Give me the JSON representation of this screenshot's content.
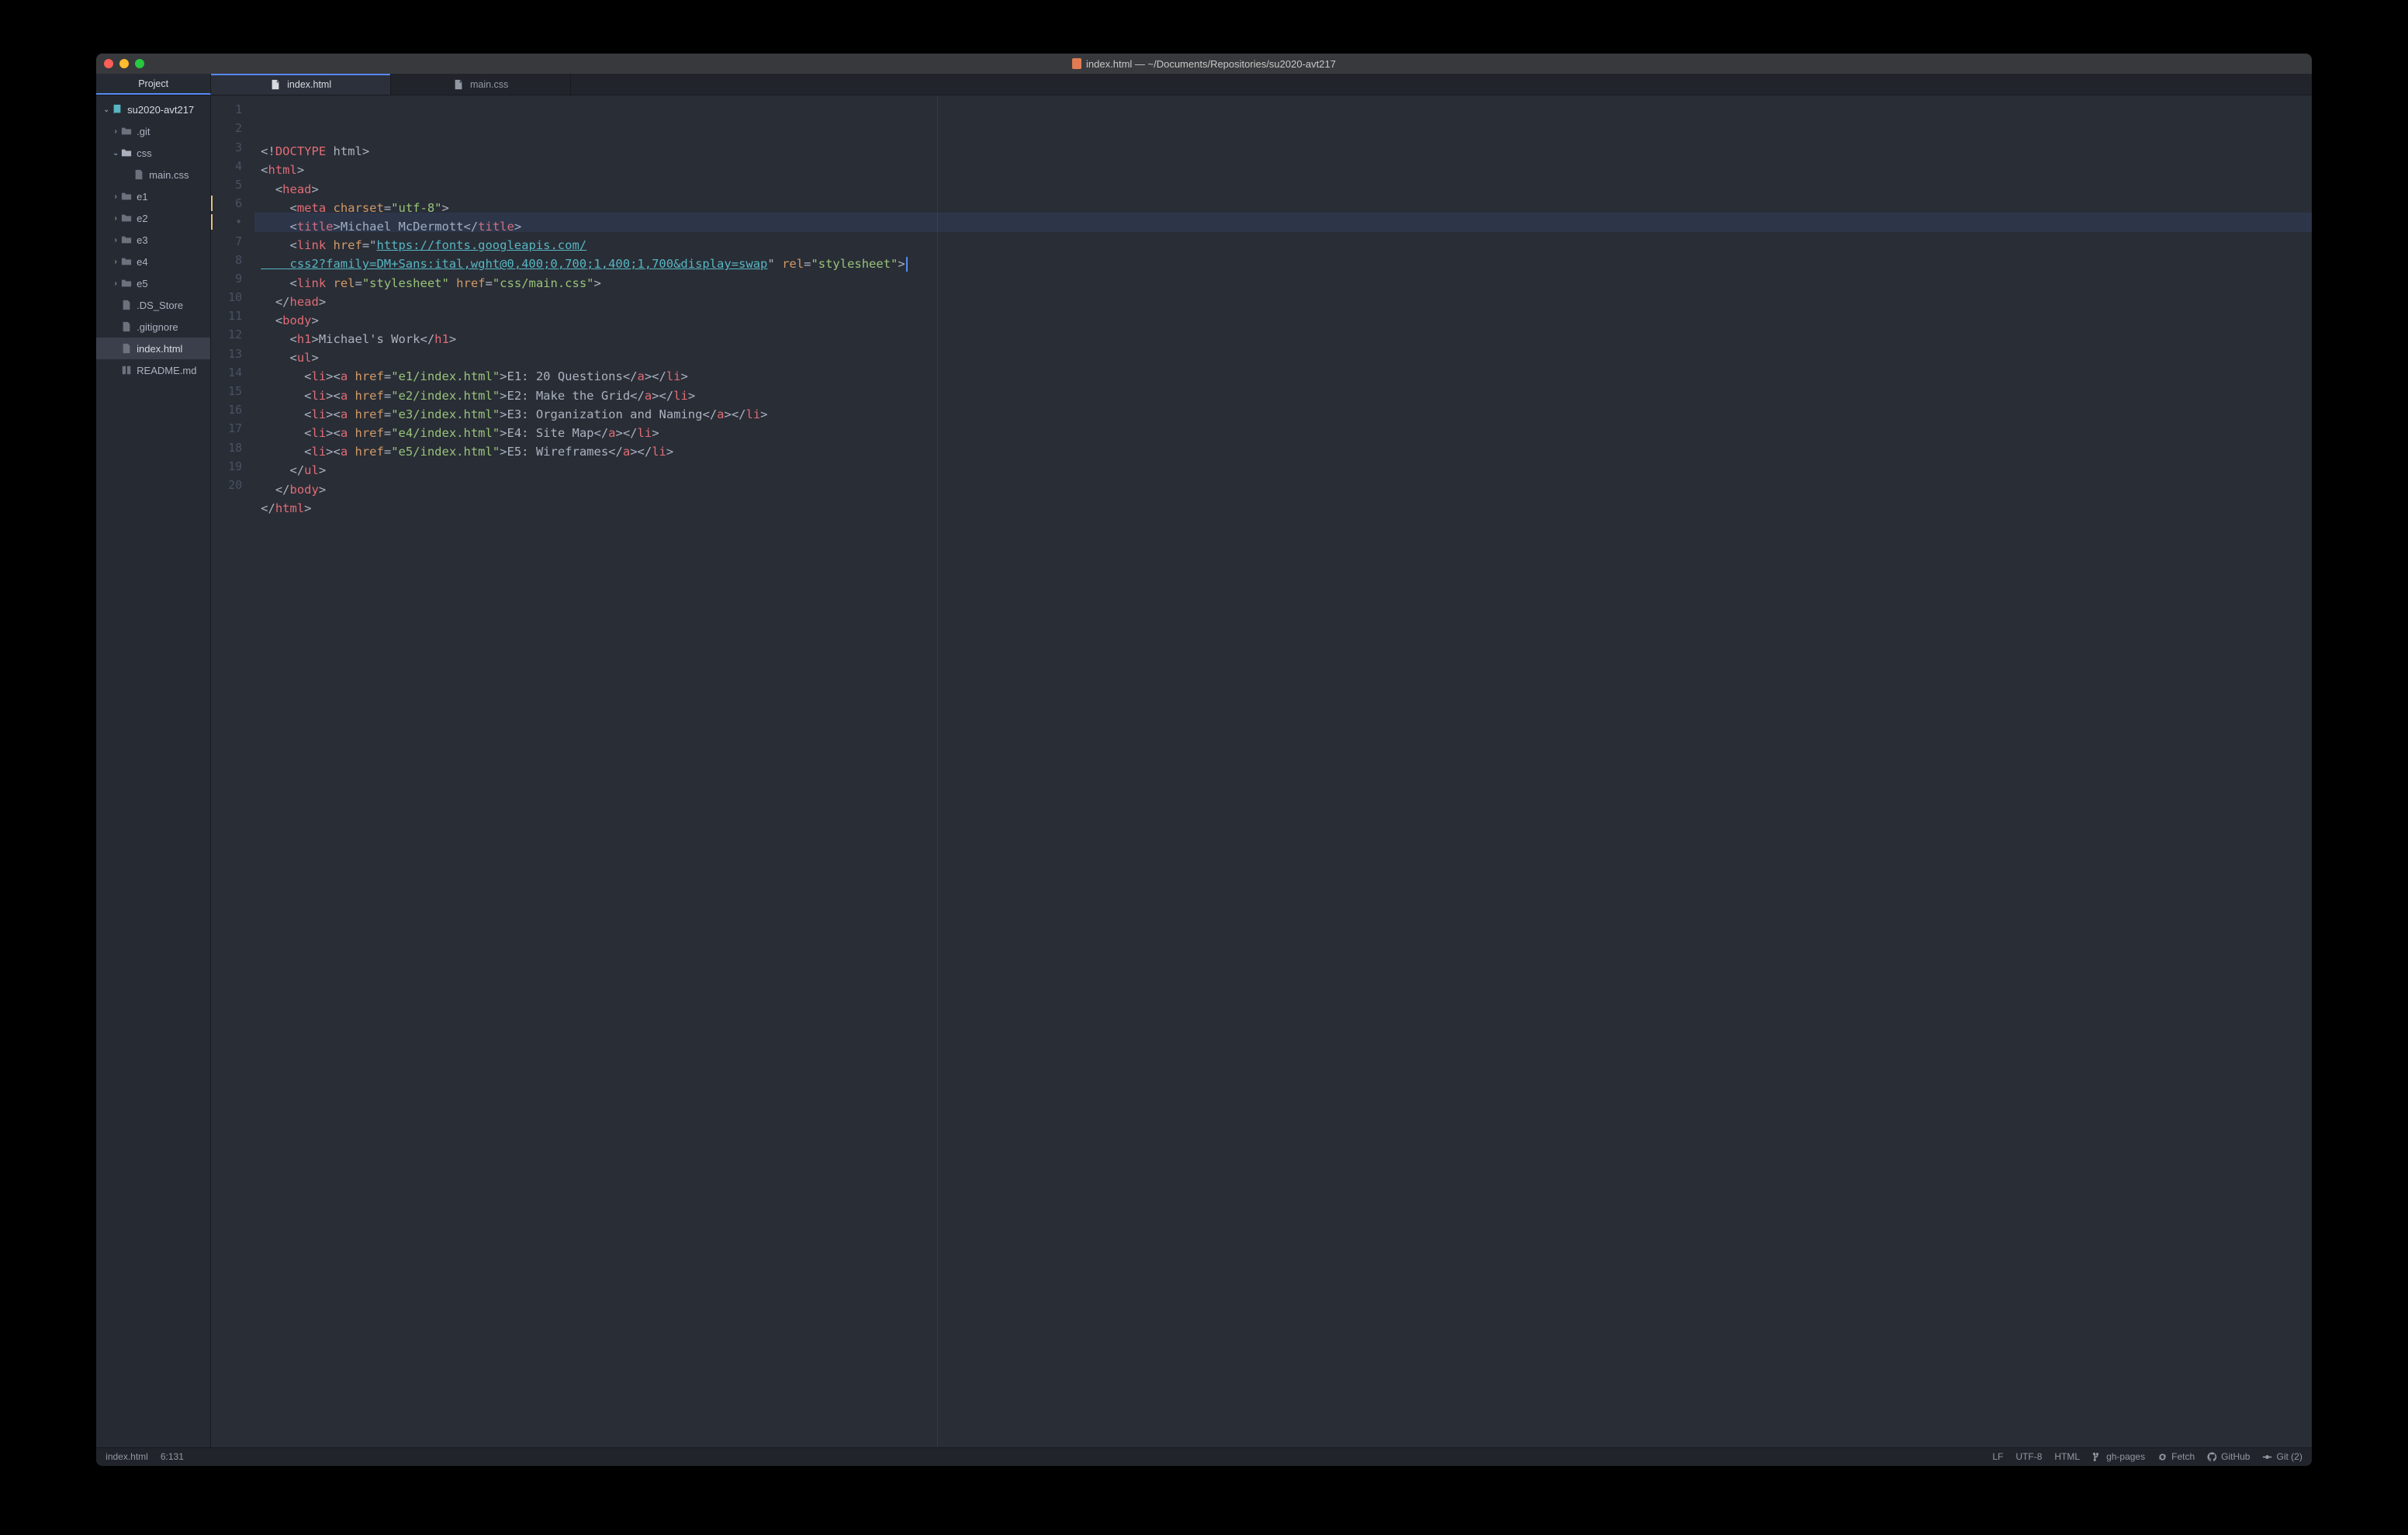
{
  "window_title": "index.html — ~/Documents/Repositories/su2020-avt217",
  "panel_tab": "Project",
  "tabs": [
    {
      "label": "index.html",
      "active": true
    },
    {
      "label": "main.css",
      "active": false
    }
  ],
  "tree": {
    "root": "su2020-avt217",
    "items": [
      {
        "kind": "folder",
        "name": ".git",
        "depth": 1,
        "open": false
      },
      {
        "kind": "folder",
        "name": "css",
        "depth": 1,
        "open": true
      },
      {
        "kind": "file",
        "name": "main.css",
        "depth": 2,
        "icon": "file"
      },
      {
        "kind": "folder",
        "name": "e1",
        "depth": 1,
        "open": false
      },
      {
        "kind": "folder",
        "name": "e2",
        "depth": 1,
        "open": false
      },
      {
        "kind": "folder",
        "name": "e3",
        "depth": 1,
        "open": false
      },
      {
        "kind": "folder",
        "name": "e4",
        "depth": 1,
        "open": false
      },
      {
        "kind": "folder",
        "name": "e5",
        "depth": 1,
        "open": false
      },
      {
        "kind": "file",
        "name": ".DS_Store",
        "depth": 1,
        "icon": "file"
      },
      {
        "kind": "file",
        "name": ".gitignore",
        "depth": 1,
        "icon": "file"
      },
      {
        "kind": "file",
        "name": "index.html",
        "depth": 1,
        "icon": "file",
        "selected": true
      },
      {
        "kind": "file",
        "name": "README.md",
        "depth": 1,
        "icon": "book"
      }
    ]
  },
  "gutter": [
    "1",
    "2",
    "3",
    "4",
    "5",
    "6",
    "•",
    "7",
    "8",
    "9",
    "10",
    "11",
    "12",
    "13",
    "14",
    "15",
    "16",
    "17",
    "18",
    "19",
    "20"
  ],
  "gutter_mod_marks": [
    5,
    6
  ],
  "highlight_line_index": 6,
  "code": [
    [
      [
        "p",
        "<!"
      ],
      [
        "t",
        "DOCTYPE"
      ],
      [
        "p",
        " html>"
      ]
    ],
    [
      [
        "p",
        "<"
      ],
      [
        "t",
        "html"
      ],
      [
        "p",
        ">"
      ]
    ],
    [
      [
        "p",
        "  <"
      ],
      [
        "t",
        "head"
      ],
      [
        "p",
        ">"
      ]
    ],
    [
      [
        "p",
        "    <"
      ],
      [
        "t",
        "meta"
      ],
      [
        "p",
        " "
      ],
      [
        "a",
        "charset"
      ],
      [
        "p",
        "="
      ],
      [
        "s",
        "\"utf-8\""
      ],
      [
        "p",
        ">"
      ]
    ],
    [
      [
        "p",
        "    <"
      ],
      [
        "t",
        "title"
      ],
      [
        "p",
        ">"
      ],
      [
        "tx",
        "Michael McDermott"
      ],
      [
        "p",
        "</"
      ],
      [
        "t",
        "title"
      ],
      [
        "p",
        ">"
      ]
    ],
    [
      [
        "p",
        "    <"
      ],
      [
        "t",
        "link"
      ],
      [
        "p",
        " "
      ],
      [
        "a",
        "href"
      ],
      [
        "p",
        "=\""
      ],
      [
        "u",
        "https://fonts.googleapis.com/"
      ]
    ],
    [
      [
        "u",
        "    css2?family=DM+Sans:ital,wght@0,400;0,700;1,400;1,700&display=swap"
      ],
      [
        "p",
        "\" "
      ],
      [
        "a",
        "rel"
      ],
      [
        "p",
        "="
      ],
      [
        "s",
        "\"stylesheet\""
      ],
      [
        "p",
        ">"
      ],
      [
        "cursor",
        ""
      ]
    ],
    [
      [
        "p",
        "    <"
      ],
      [
        "t",
        "link"
      ],
      [
        "p",
        " "
      ],
      [
        "a",
        "rel"
      ],
      [
        "p",
        "="
      ],
      [
        "s",
        "\"stylesheet\""
      ],
      [
        "p",
        " "
      ],
      [
        "a",
        "href"
      ],
      [
        "p",
        "="
      ],
      [
        "s",
        "\"css/main.css\""
      ],
      [
        "p",
        ">"
      ]
    ],
    [
      [
        "p",
        "  </"
      ],
      [
        "t",
        "head"
      ],
      [
        "p",
        ">"
      ]
    ],
    [
      [
        "p",
        "  <"
      ],
      [
        "t",
        "body"
      ],
      [
        "p",
        ">"
      ]
    ],
    [
      [
        "p",
        "    <"
      ],
      [
        "t",
        "h1"
      ],
      [
        "p",
        ">"
      ],
      [
        "tx",
        "Michael's Work"
      ],
      [
        "p",
        "</"
      ],
      [
        "t",
        "h1"
      ],
      [
        "p",
        ">"
      ]
    ],
    [
      [
        "p",
        "    <"
      ],
      [
        "t",
        "ul"
      ],
      [
        "p",
        ">"
      ]
    ],
    [
      [
        "p",
        "      <"
      ],
      [
        "t",
        "li"
      ],
      [
        "p",
        "><"
      ],
      [
        "t",
        "a"
      ],
      [
        "p",
        " "
      ],
      [
        "a",
        "href"
      ],
      [
        "p",
        "="
      ],
      [
        "s",
        "\"e1/index.html\""
      ],
      [
        "p",
        ">"
      ],
      [
        "tx",
        "E1: 20 Questions"
      ],
      [
        "p",
        "</"
      ],
      [
        "t",
        "a"
      ],
      [
        "p",
        "></"
      ],
      [
        "t",
        "li"
      ],
      [
        "p",
        ">"
      ]
    ],
    [
      [
        "p",
        "      <"
      ],
      [
        "t",
        "li"
      ],
      [
        "p",
        "><"
      ],
      [
        "t",
        "a"
      ],
      [
        "p",
        " "
      ],
      [
        "a",
        "href"
      ],
      [
        "p",
        "="
      ],
      [
        "s",
        "\"e2/index.html\""
      ],
      [
        "p",
        ">"
      ],
      [
        "tx",
        "E2: Make the Grid"
      ],
      [
        "p",
        "</"
      ],
      [
        "t",
        "a"
      ],
      [
        "p",
        "></"
      ],
      [
        "t",
        "li"
      ],
      [
        "p",
        ">"
      ]
    ],
    [
      [
        "p",
        "      <"
      ],
      [
        "t",
        "li"
      ],
      [
        "p",
        "><"
      ],
      [
        "t",
        "a"
      ],
      [
        "p",
        " "
      ],
      [
        "a",
        "href"
      ],
      [
        "p",
        "="
      ],
      [
        "s",
        "\"e3/index.html\""
      ],
      [
        "p",
        ">"
      ],
      [
        "tx",
        "E3: Organization and Naming"
      ],
      [
        "p",
        "</"
      ],
      [
        "t",
        "a"
      ],
      [
        "p",
        "></"
      ],
      [
        "t",
        "li"
      ],
      [
        "p",
        ">"
      ]
    ],
    [
      [
        "p",
        "      <"
      ],
      [
        "t",
        "li"
      ],
      [
        "p",
        "><"
      ],
      [
        "t",
        "a"
      ],
      [
        "p",
        " "
      ],
      [
        "a",
        "href"
      ],
      [
        "p",
        "="
      ],
      [
        "s",
        "\"e4/index.html\""
      ],
      [
        "p",
        ">"
      ],
      [
        "tx",
        "E4: Site Map"
      ],
      [
        "p",
        "</"
      ],
      [
        "t",
        "a"
      ],
      [
        "p",
        "></"
      ],
      [
        "t",
        "li"
      ],
      [
        "p",
        ">"
      ]
    ],
    [
      [
        "p",
        "      <"
      ],
      [
        "t",
        "li"
      ],
      [
        "p",
        "><"
      ],
      [
        "t",
        "a"
      ],
      [
        "p",
        " "
      ],
      [
        "a",
        "href"
      ],
      [
        "p",
        "="
      ],
      [
        "s",
        "\"e5/index.html\""
      ],
      [
        "p",
        ">"
      ],
      [
        "tx",
        "E5: Wireframes"
      ],
      [
        "p",
        "</"
      ],
      [
        "t",
        "a"
      ],
      [
        "p",
        "></"
      ],
      [
        "t",
        "li"
      ],
      [
        "p",
        ">"
      ]
    ],
    [
      [
        "p",
        "    </"
      ],
      [
        "t",
        "ul"
      ],
      [
        "p",
        ">"
      ]
    ],
    [
      [
        "p",
        "  </"
      ],
      [
        "t",
        "body"
      ],
      [
        "p",
        ">"
      ]
    ],
    [
      [
        "p",
        "</"
      ],
      [
        "t",
        "html"
      ],
      [
        "p",
        ">"
      ]
    ],
    [
      [
        "p",
        ""
      ]
    ]
  ],
  "status": {
    "file": "index.html",
    "cursor": "6:131",
    "line_ending": "LF",
    "encoding": "UTF-8",
    "lang": "HTML",
    "branch": "gh-pages",
    "fetch": "Fetch",
    "github": "GitHub",
    "git": "Git (2)"
  }
}
